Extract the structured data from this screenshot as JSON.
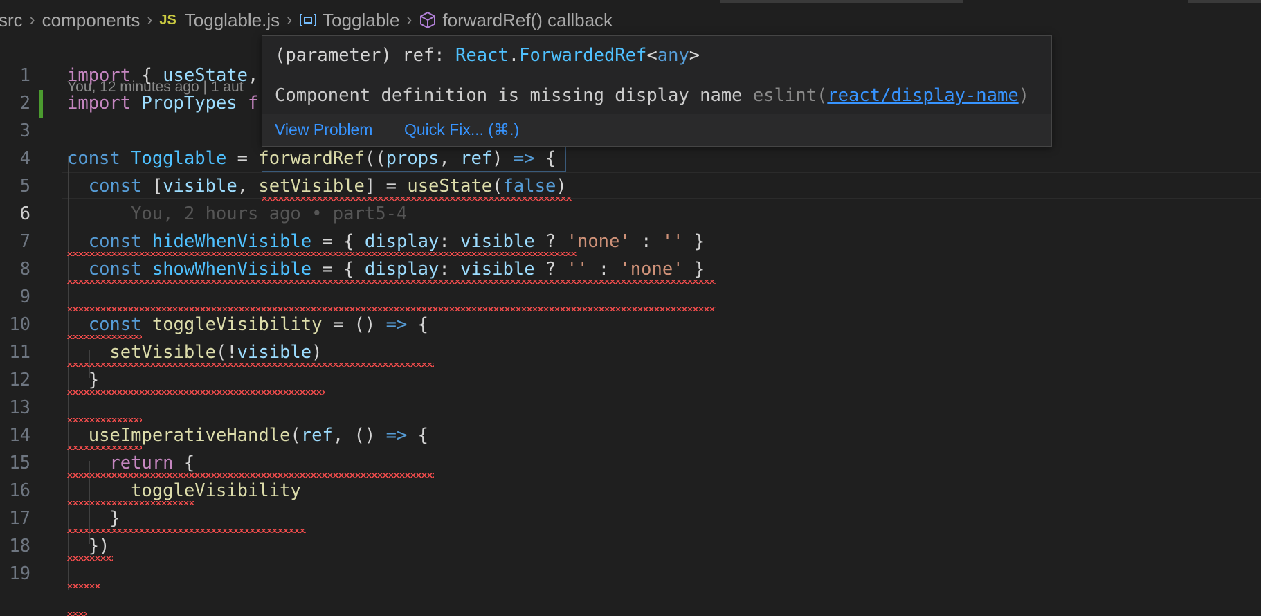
{
  "breadcrumb": {
    "src": "src",
    "components": "components",
    "js_badge": "JS",
    "file": "Togglable.js",
    "symbol": "Togglable",
    "callback": "forwardRef() callback"
  },
  "blame_header": "You, 12 minutes ago | 1 aut",
  "inline_blame": "You, 2 hours ago • part5-4",
  "hover": {
    "sig": [
      "(parameter)",
      " ref: ",
      "React",
      ".",
      "ForwardedRef",
      "<",
      "any",
      ">"
    ],
    "message": "Component definition is missing display name ",
    "eslint_prefix": "eslint(",
    "rule_link": "react/display-name",
    "eslint_suffix": ")",
    "view_problem": "View Problem",
    "quick_fix": "Quick Fix... (⌘.)"
  },
  "line_numbers": [
    "1",
    "2",
    "3",
    "4",
    "5",
    "6",
    "7",
    "8",
    "9",
    "10",
    "11",
    "12",
    "13",
    "14",
    "15",
    "16",
    "17",
    "18",
    "19"
  ],
  "active_line": 6,
  "code_lines": [
    [
      [
        "kw",
        "import"
      ],
      [
        "pun",
        " { "
      ],
      [
        "var",
        "useState"
      ],
      [
        "pun",
        ","
      ]
    ],
    [
      [
        "kw",
        "import"
      ],
      [
        "pun",
        " "
      ],
      [
        "var",
        "PropTypes"
      ],
      [
        "pun",
        " "
      ],
      [
        "kw",
        "f"
      ]
    ],
    [],
    [
      [
        "st",
        "const"
      ],
      [
        "pun",
        " "
      ],
      [
        "cst",
        "Togglable"
      ],
      [
        "pun",
        " = "
      ],
      [
        "fn",
        "forwardRef"
      ],
      [
        "pun",
        "(("
      ],
      [
        "var",
        "props"
      ],
      [
        "pun",
        ", "
      ],
      [
        "var",
        "ref"
      ],
      [
        "pun",
        ") "
      ],
      [
        "st",
        "=>"
      ],
      [
        "pun",
        " {"
      ]
    ],
    [
      [
        "pun",
        "  "
      ],
      [
        "st",
        "const"
      ],
      [
        "pun",
        " ["
      ],
      [
        "var",
        "visible"
      ],
      [
        "pun",
        ", "
      ],
      [
        "fn",
        "setVisible"
      ],
      [
        "pun",
        "] = "
      ],
      [
        "fn",
        "useState"
      ],
      [
        "pun",
        "("
      ],
      [
        "st",
        "false"
      ],
      [
        "pun",
        ")"
      ]
    ],
    [
      [
        "ghost",
        "      You, 2 hours ago • part5-4"
      ]
    ],
    [
      [
        "pun",
        "  "
      ],
      [
        "st",
        "const"
      ],
      [
        "pun",
        " "
      ],
      [
        "cst",
        "hideWhenVisible"
      ],
      [
        "pun",
        " = { "
      ],
      [
        "var",
        "display"
      ],
      [
        "pun",
        ": "
      ],
      [
        "var",
        "visible"
      ],
      [
        "pun",
        " ? "
      ],
      [
        "str",
        "'none'"
      ],
      [
        "pun",
        " : "
      ],
      [
        "str",
        "''"
      ],
      [
        "pun",
        " }"
      ]
    ],
    [
      [
        "pun",
        "  "
      ],
      [
        "st",
        "const"
      ],
      [
        "pun",
        " "
      ],
      [
        "cst",
        "showWhenVisible"
      ],
      [
        "pun",
        " = { "
      ],
      [
        "var",
        "display"
      ],
      [
        "pun",
        ": "
      ],
      [
        "var",
        "visible"
      ],
      [
        "pun",
        " ? "
      ],
      [
        "str",
        "''"
      ],
      [
        "pun",
        " : "
      ],
      [
        "str",
        "'none'"
      ],
      [
        "pun",
        " }"
      ]
    ],
    [],
    [
      [
        "pun",
        "  "
      ],
      [
        "st",
        "const"
      ],
      [
        "pun",
        " "
      ],
      [
        "fn",
        "toggleVisibility"
      ],
      [
        "pun",
        " = () "
      ],
      [
        "st",
        "=>"
      ],
      [
        "pun",
        " {"
      ]
    ],
    [
      [
        "pun",
        "    "
      ],
      [
        "fn",
        "setVisible"
      ],
      [
        "pun",
        "(!"
      ],
      [
        "var",
        "visible"
      ],
      [
        "pun",
        ")"
      ]
    ],
    [
      [
        "pun",
        "  }"
      ]
    ],
    [],
    [
      [
        "pun",
        "  "
      ],
      [
        "fn",
        "useImperativeHandle"
      ],
      [
        "pun",
        "("
      ],
      [
        "var",
        "ref"
      ],
      [
        "pun",
        ", () "
      ],
      [
        "st",
        "=>"
      ],
      [
        "pun",
        " {"
      ]
    ],
    [
      [
        "pun",
        "    "
      ],
      [
        "kw",
        "return"
      ],
      [
        "pun",
        " {"
      ]
    ],
    [
      [
        "pun",
        "      "
      ],
      [
        "fn",
        "toggleVisibility"
      ]
    ],
    [
      [
        "pun",
        "    }"
      ]
    ],
    [
      [
        "pun",
        "  })"
      ]
    ],
    []
  ]
}
